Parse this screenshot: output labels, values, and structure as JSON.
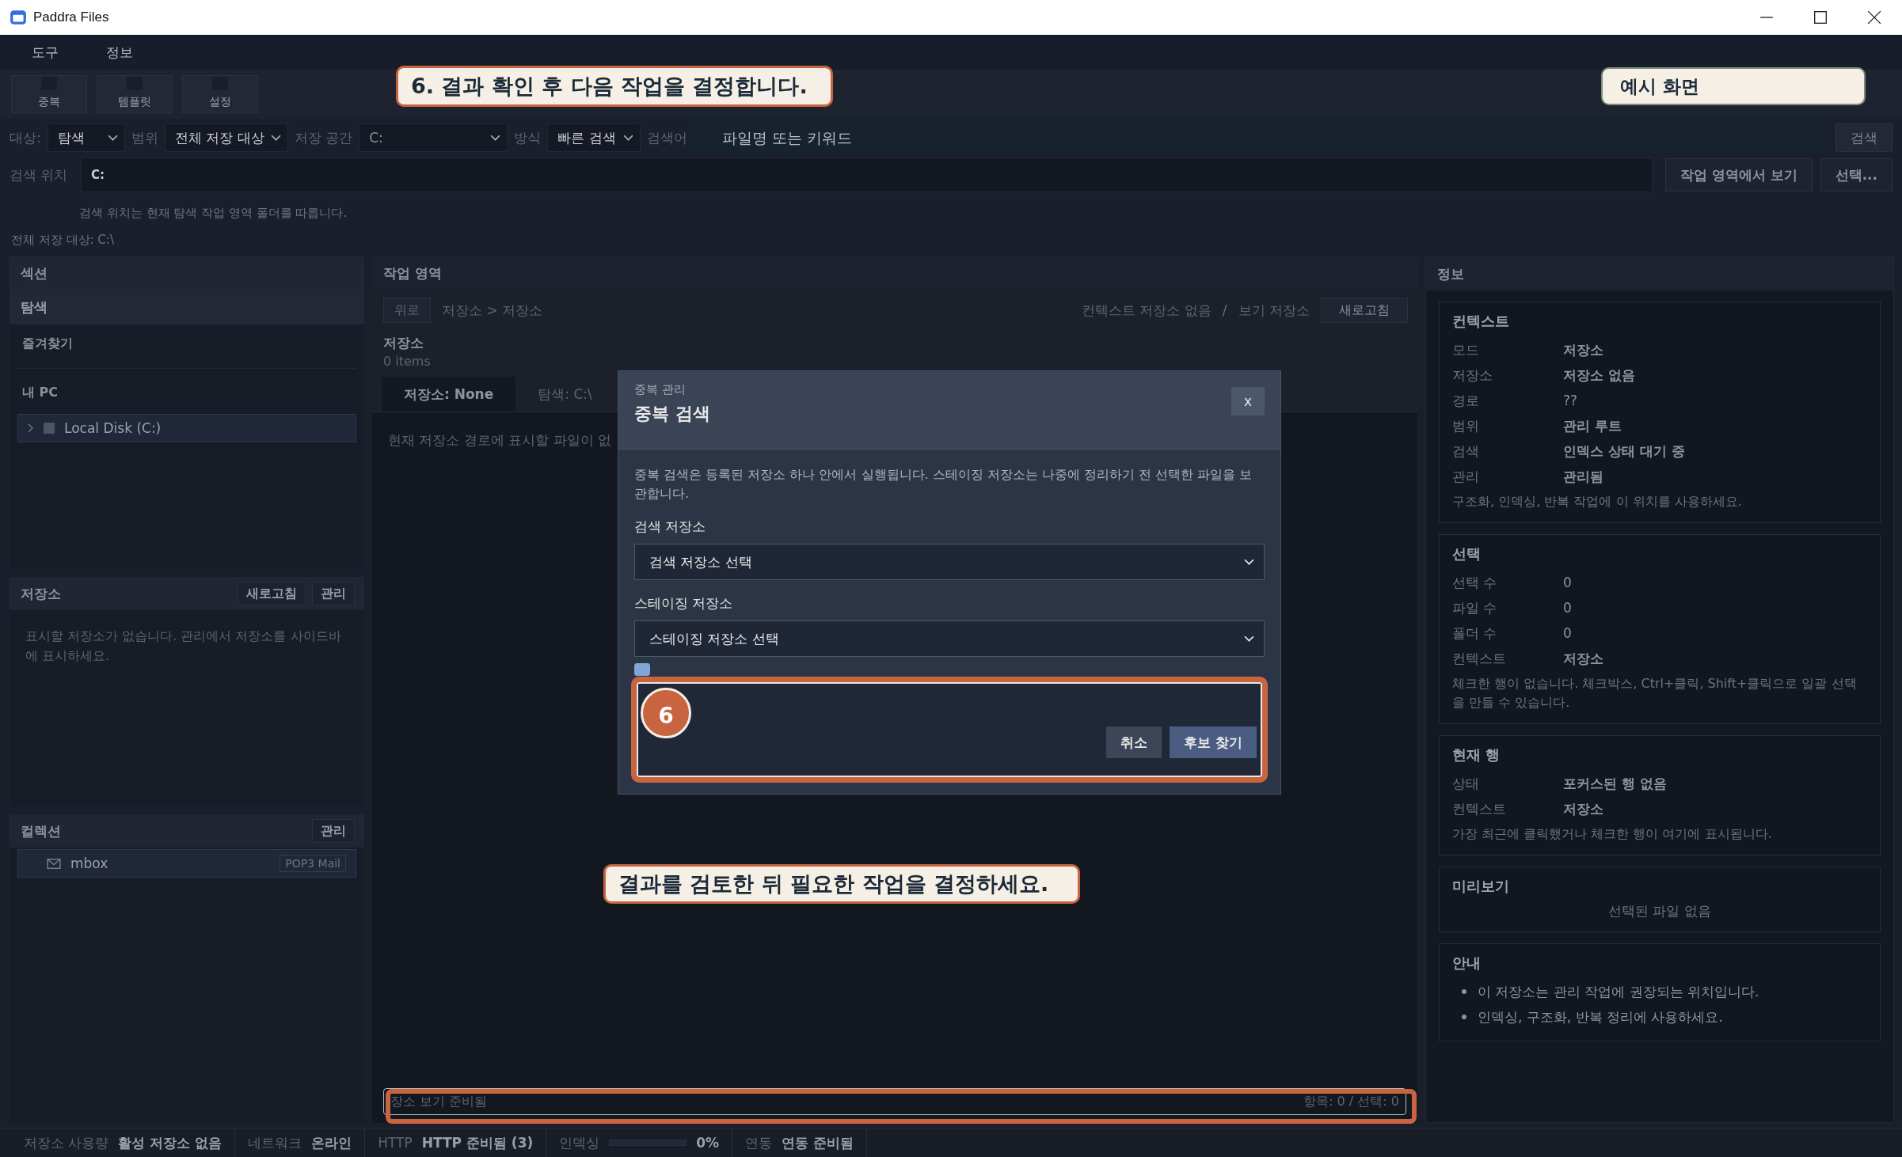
{
  "window": {
    "title": "Paddra Files"
  },
  "menu": [
    "도구",
    "정보"
  ],
  "toolbar": [
    "중복",
    "템플릿",
    "설정"
  ],
  "top_callout": "6. 결과 확인 후 다음 작업을 결정합니다.",
  "sample_badge": "예시 화면",
  "search_bar": {
    "filters": [
      {
        "label": "대상:",
        "value": "탐색"
      },
      {
        "label": "범위",
        "value": "전체 저장 대상"
      },
      {
        "label": "저장 공간",
        "value": "C:"
      },
      {
        "label": "방식",
        "value": "빠른 검색"
      }
    ],
    "keyword_label": "검색어",
    "keyword_placeholder": "파일명 또는 키워드",
    "search_button": "검색"
  },
  "location": {
    "label": "검색 위치",
    "value": "C:",
    "buttons": [
      "작업 영역에서 보기",
      "선택..."
    ],
    "hint": "검색 위치는 현재 탐색 작업 영역 폴더를 따릅니다.",
    "all_targets": "전체 저장 대상: C:\\"
  },
  "sidebar": {
    "title": "섹션",
    "nav": "탐색",
    "favorites": "즐겨찾기",
    "pc_group": "내 PC",
    "drives": [
      {
        "label": "Local Disk (C:)",
        "selected": true
      }
    ]
  },
  "storage_panel": {
    "title": "저장소",
    "buttons": [
      "새로고침",
      "관리"
    ],
    "empty": "표시할 저장소가 없습니다. 관리에서 저장소를 사이드바에 표시하세요."
  },
  "collections": {
    "title": "컬렉션",
    "buttons": [
      "관리"
    ],
    "items": [
      {
        "name": "mbox",
        "tag": "POP3 Mail"
      }
    ]
  },
  "workspace": {
    "title": "작업 영역",
    "up_button": "위로",
    "breadcrumb": "저장소 > 저장소",
    "context": "컨텍스트 저장소 없음",
    "separator": "/",
    "view_store": "보기 저장소",
    "refresh": "새로고침",
    "heading": "저장소",
    "count": "0 items",
    "tabs": [
      {
        "label": "저장소: None",
        "selected": true
      },
      {
        "label": "탐색: C:\\",
        "selected": false
      }
    ],
    "empty": "현재 저장소 경로에 표시할 파일이 없",
    "footer_left": "장소 보기 준비됨",
    "footer_right": "항목: 0 / 선택: 0"
  },
  "dialog": {
    "kicker": "중복 관리",
    "title": "중복 검색",
    "close": "x",
    "description": "중복 검색은 등록된 저장소 하나 안에서 실행됩니다. 스테이징 저장소는 나중에 정리하기 전 선택한 파일을 보관합니다.",
    "fields": [
      {
        "label": "검색 저장소",
        "value": "검색 저장소 선택"
      },
      {
        "label": "스테이징 저장소",
        "value": "스테이징 저장소 선택"
      }
    ],
    "checkbox": {
      "checked": true
    },
    "buttons": [
      {
        "label": "취소",
        "kind": "secondary"
      },
      {
        "label": "후보 찾기",
        "kind": "primary"
      }
    ],
    "step": "6"
  },
  "bottom_callout": "결과를 검토한 뒤 필요한 작업을 결정하세요.",
  "info": {
    "title": "정보",
    "cards": [
      {
        "title": "컨텍스트",
        "rows": [
          {
            "label": "모드",
            "value": "저장소",
            "bold": true
          },
          {
            "label": "저장소",
            "value": "저장소 없음",
            "bold": true
          },
          {
            "label": "경로",
            "value": "??",
            "bold": false
          },
          {
            "label": "범위",
            "value": "관리 루트",
            "bold": true
          },
          {
            "label": "검색",
            "value": "인덱스 상태 대기 중",
            "bold": true
          },
          {
            "label": "관리",
            "value": "관리됨",
            "bold": true
          }
        ],
        "note": "구조화, 인덱싱, 반복 작업에 이 위치를 사용하세요."
      },
      {
        "title": "선택",
        "rows": [
          {
            "label": "선택 수",
            "value": "0",
            "bold": false
          },
          {
            "label": "파일 수",
            "value": "0",
            "bold": false
          },
          {
            "label": "폴더 수",
            "value": "0",
            "bold": false
          },
          {
            "label": "컨텍스트",
            "value": "저장소",
            "bold": true
          }
        ],
        "note": "체크한 행이 없습니다. 체크박스, Ctrl+클릭, Shift+클릭으로 일괄 선택을 만들 수 있습니다."
      },
      {
        "title": "현재 행",
        "rows": [
          {
            "label": "상태",
            "value": "포커스된 행 없음",
            "bold": true
          },
          {
            "label": "컨텍스트",
            "value": "저장소",
            "bold": true
          }
        ],
        "note": "가장 최근에 클릭했거나 체크한 행이 여기에 표시됩니다."
      }
    ],
    "preview": {
      "title": "미리보기",
      "empty": "선택된 파일 없음"
    },
    "guide": {
      "title": "안내",
      "bullets": [
        "이 저장소는 관리 작업에 권장되는 위치입니다.",
        "인덱싱, 구조화, 반복 정리에 사용하세요."
      ]
    }
  },
  "status_bar": {
    "items": [
      {
        "label": "저장소 사용량",
        "value": "활성 저장소 없음"
      },
      {
        "label": "네트워크",
        "value": "온라인"
      },
      {
        "label": "HTTP",
        "value": "HTTP 준비됨 (3)"
      }
    ],
    "indexing": {
      "label": "인덱싱",
      "level": 0,
      "reading": "0%"
    },
    "sync": {
      "label": "연동",
      "value": "연동 준비됨"
    }
  }
}
